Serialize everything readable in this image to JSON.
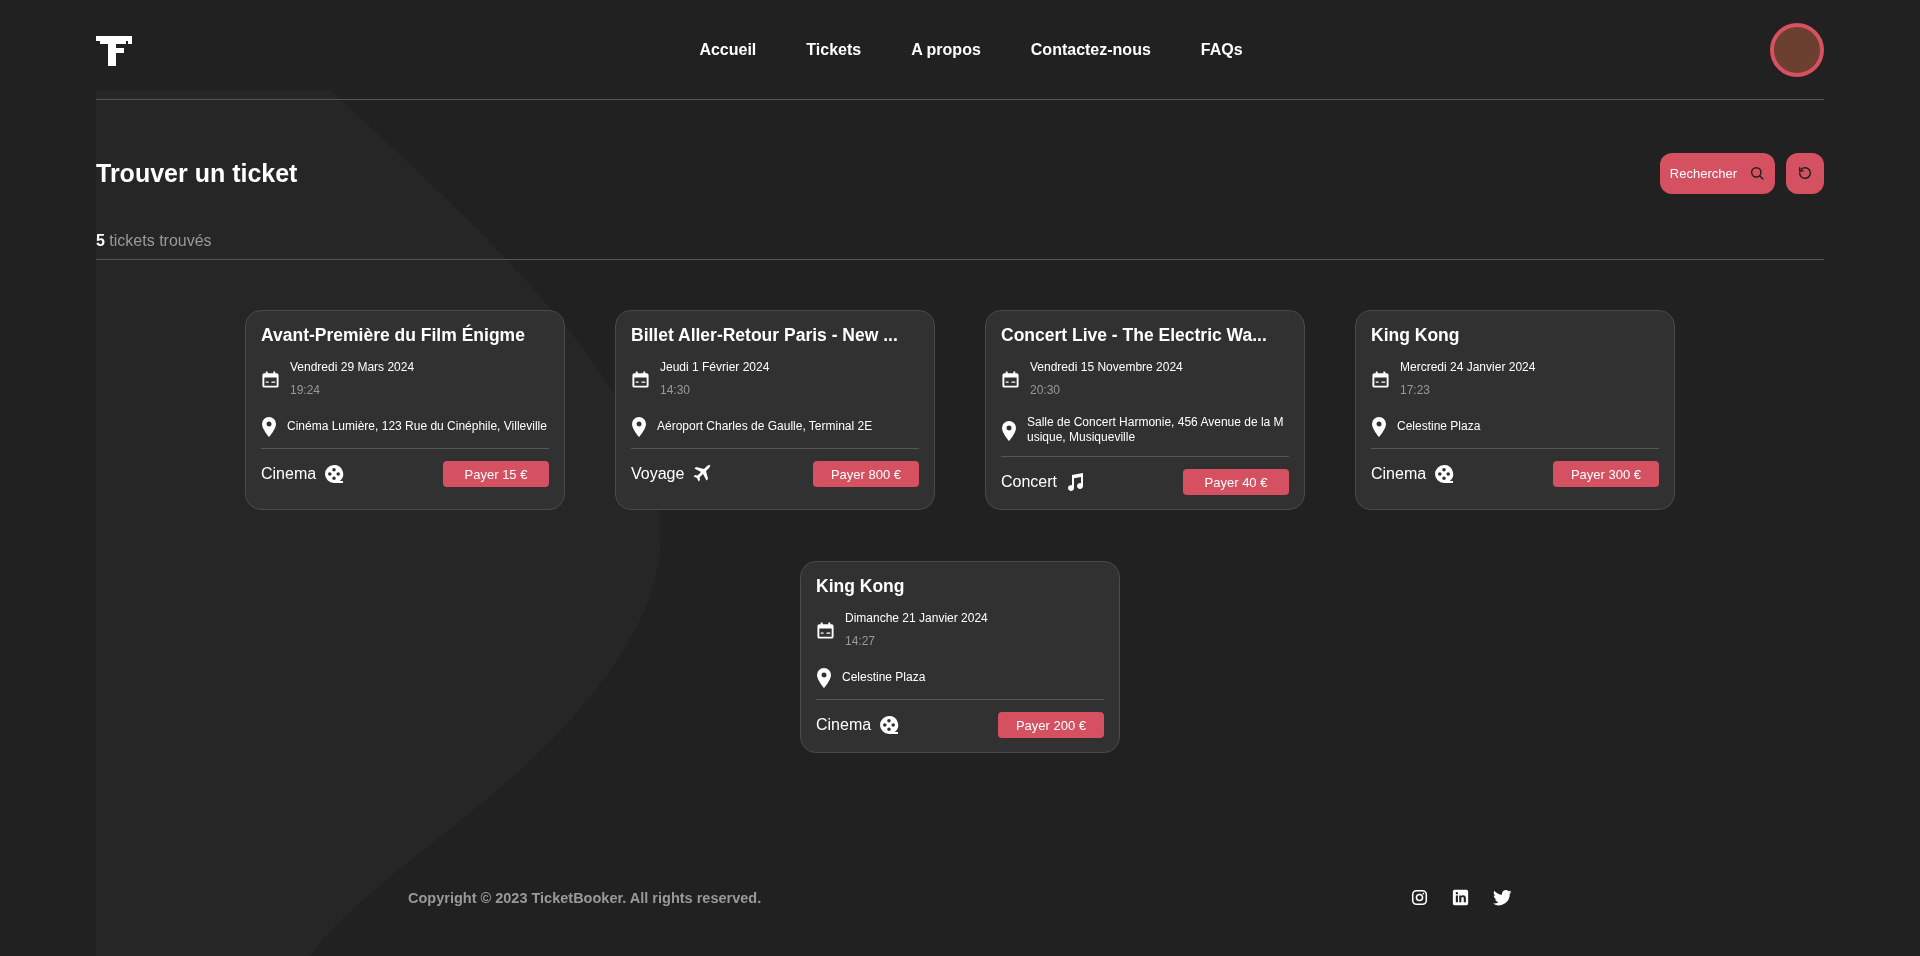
{
  "nav": {
    "links": [
      {
        "label": "Accueil"
      },
      {
        "label": "Tickets"
      },
      {
        "label": "A propos"
      },
      {
        "label": "Contactez-nous"
      },
      {
        "label": "FAQs"
      }
    ]
  },
  "page_title": "Trouver un ticket",
  "search_button": {
    "label": "Rechercher"
  },
  "result_count": {
    "count": "5",
    "label": "tickets trouvés"
  },
  "tickets": [
    {
      "title": "Avant-Première du Film Énigme",
      "date": "Vendredi 29 Mars 2024",
      "time": "19:24",
      "location": "Cinéma Lumière, 123 Rue du Cinéphile, Villeville",
      "category": "Cinema",
      "kind": "cinema",
      "pay": "Payer 15 €"
    },
    {
      "title": "Billet Aller-Retour Paris - New ...",
      "date": "Jeudi 1 Février 2024",
      "time": "14:30",
      "location": "Aéroport Charles de Gaulle, Terminal 2E",
      "category": "Voyage",
      "kind": "voyage",
      "pay": "Payer 800 €"
    },
    {
      "title": "Concert Live - The Electric Wa...",
      "date": "Vendredi 15 Novembre 2024",
      "time": "20:30",
      "location": "Salle de Concert Harmonie, 456 Avenue de la Musique, Musiqueville",
      "category": "Concert",
      "kind": "concert",
      "pay": "Payer 40 €"
    },
    {
      "title": "King Kong",
      "date": "Mercredi 24 Janvier 2024",
      "time": "17:23",
      "location": "Celestine Plaza",
      "category": "Cinema",
      "kind": "cinema",
      "pay": "Payer 300 €"
    },
    {
      "title": "King Kong",
      "date": "Dimanche 21 Janvier 2024",
      "time": "14:27",
      "location": "Celestine Plaza",
      "category": "Cinema",
      "kind": "cinema",
      "pay": "Payer 200 €"
    }
  ],
  "footer": {
    "copyright": "Copyright © 2023 TicketBooker. All rights reserved."
  }
}
